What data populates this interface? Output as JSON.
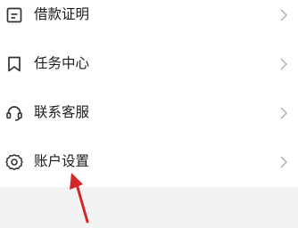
{
  "menu": {
    "items": [
      {
        "label": "借款证明",
        "icon": "document-icon"
      },
      {
        "label": "任务中心",
        "icon": "bookmark-icon"
      },
      {
        "label": "联系客服",
        "icon": "headset-icon"
      },
      {
        "label": "账户设置",
        "icon": "gear-icon"
      }
    ]
  },
  "colors": {
    "text": "#1c1c1c",
    "icon": "#333333",
    "chevron": "#b9b9b9",
    "annotation_arrow": "#d7262b",
    "background": "#f3f3f3"
  }
}
